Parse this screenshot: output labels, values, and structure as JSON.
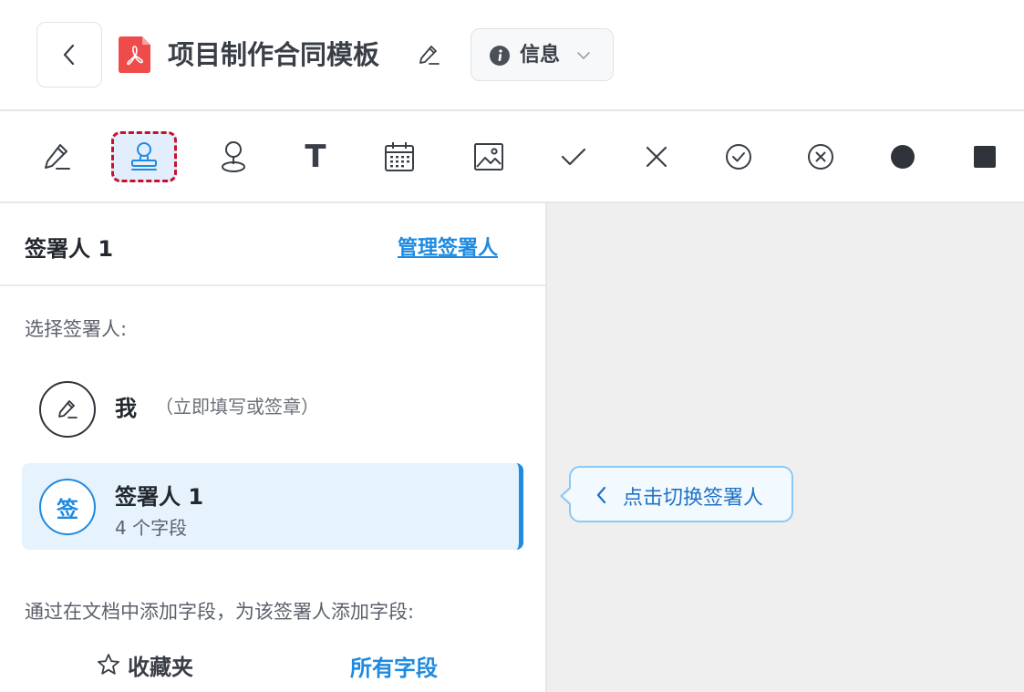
{
  "header": {
    "title": "项目制作合同模板",
    "info_label": "信息"
  },
  "toolbar": {
    "text_tool_glyph": "T"
  },
  "panel": {
    "heading": "签署人 1",
    "manage_link": "管理签署人",
    "choose_label": "选择签署人:",
    "signers": [
      {
        "name": "我",
        "note": "（立即填写或签章）"
      },
      {
        "avatar": "签",
        "name": "签署人 1",
        "fields": "4 个字段",
        "selected": true
      }
    ],
    "add_hint": "通过在文档中添加字段，为该签署人添加字段:",
    "tabs": {
      "favorites": "收藏夹",
      "all_fields": "所有字段"
    }
  },
  "canvas": {
    "tip_text": "点击切换签署人"
  },
  "colors": {
    "accent": "#1f8ae0",
    "selected_bg": "#e6f3fd",
    "highlight_dash": "#c8102e",
    "pdf_red": "#f04b4b"
  }
}
